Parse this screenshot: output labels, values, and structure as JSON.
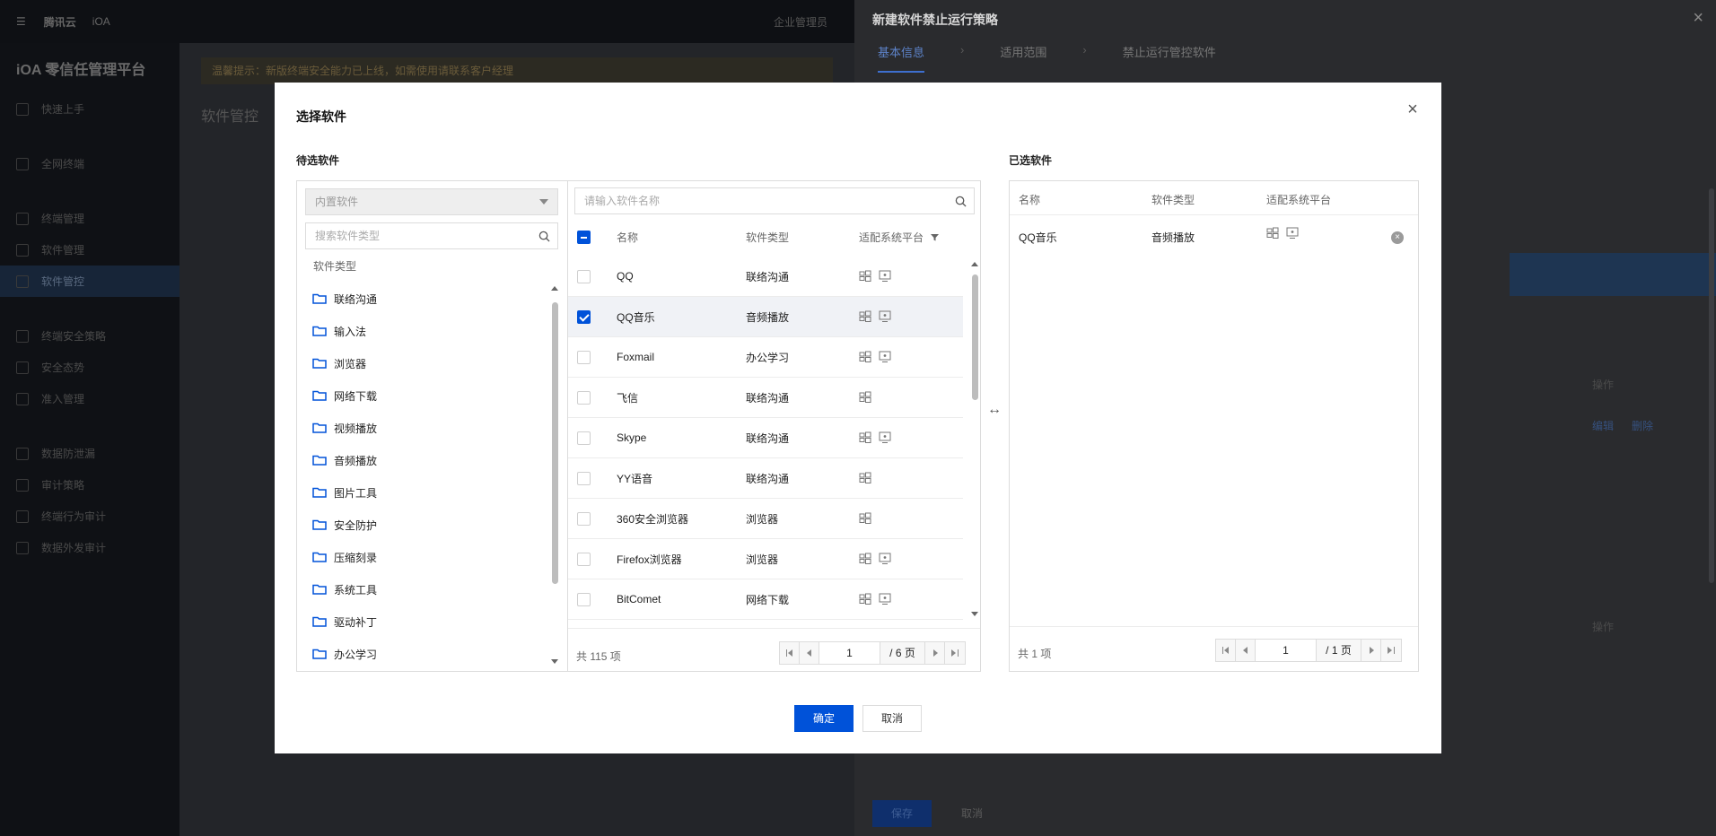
{
  "background": {
    "logo": "腾讯云",
    "brand": "iOA",
    "topbar_right": "企业管理员",
    "sidebar_title": "iOA 零信任管理平台",
    "sidebar_items": [
      "快速上手",
      "全网终端",
      "终端管理",
      "软件管理",
      "软件管控",
      "终端安全策略",
      "安全态势",
      "准入管理",
      "数据防泄漏",
      "审计策略",
      "终端行为审计",
      "数据外发审计"
    ],
    "notice": "温馨提示：新版终端安全能力已上线，如需使用请联系客户经理",
    "page_heading": "软件管控"
  },
  "drawer": {
    "title": "新建软件禁止运行策略",
    "steps": [
      "基本信息",
      "适用范围",
      "禁止运行管控软件"
    ],
    "edit": "编辑",
    "delete": "删除",
    "op": "操作",
    "save": "保存",
    "cancel": "取消"
  },
  "modal": {
    "title": "选择软件",
    "pending_title": "待选软件",
    "selected_title": "已选软件",
    "source_select": "内置软件",
    "type_search_placeholder": "搜索软件类型",
    "type_label": "软件类型",
    "categories": [
      "联络沟通",
      "输入法",
      "浏览器",
      "网络下载",
      "视频播放",
      "音频播放",
      "图片工具",
      "安全防护",
      "压缩刻录",
      "系统工具",
      "驱动补丁",
      "办公学习"
    ],
    "name_search_placeholder": "请输入软件名称",
    "columns": {
      "name": "名称",
      "type": "软件类型",
      "platform": "适配系统平台"
    },
    "rows": [
      {
        "name": "QQ",
        "type": "联络沟通",
        "win": true,
        "mac": true,
        "checked": false
      },
      {
        "name": "QQ音乐",
        "type": "音频播放",
        "win": true,
        "mac": true,
        "checked": true
      },
      {
        "name": "Foxmail",
        "type": "办公学习",
        "win": true,
        "mac": true,
        "checked": false
      },
      {
        "name": "飞信",
        "type": "联络沟通",
        "win": true,
        "mac": false,
        "checked": false
      },
      {
        "name": "Skype",
        "type": "联络沟通",
        "win": true,
        "mac": true,
        "checked": false
      },
      {
        "name": "YY语音",
        "type": "联络沟通",
        "win": true,
        "mac": false,
        "checked": false
      },
      {
        "name": "360安全浏览器",
        "type": "浏览器",
        "win": true,
        "mac": false,
        "checked": false
      },
      {
        "name": "Firefox浏览器",
        "type": "浏览器",
        "win": true,
        "mac": true,
        "checked": false
      },
      {
        "name": "BitComet",
        "type": "网络下载",
        "win": true,
        "mac": true,
        "checked": false
      }
    ],
    "left_total": "共 115 项",
    "left_page": "1",
    "left_pages": "/ 6 页",
    "selected_rows": [
      {
        "name": "QQ音乐",
        "type": "音频播放"
      }
    ],
    "right_total": "共 1 项",
    "right_page": "1",
    "right_pages": "/ 1 页",
    "ok": "确定",
    "cancel": "取消"
  },
  "colors": {
    "primary": "#0052d9",
    "folder": "#0052d9"
  }
}
